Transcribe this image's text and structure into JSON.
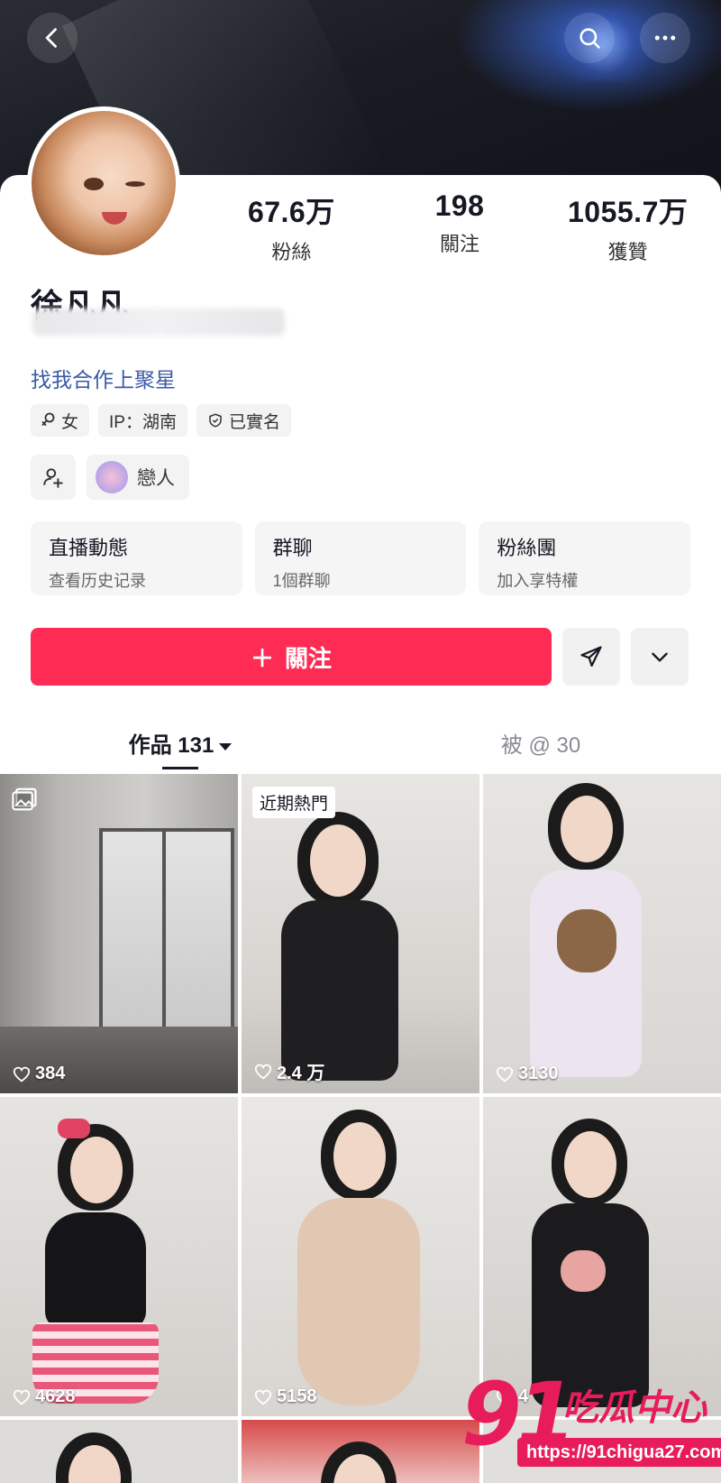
{
  "header": {
    "back_icon": "chevron-left-icon",
    "search_icon": "search-icon",
    "more_icon": "more-horizontal-icon"
  },
  "profile": {
    "name": "徐凡凡",
    "bio_link": "找我合作上聚星",
    "stats": [
      {
        "value": "67.6万",
        "label": "粉絲"
      },
      {
        "value": "198",
        "label": "關注"
      },
      {
        "value": "1055.7万",
        "label": "獲贊"
      }
    ],
    "tags": [
      {
        "icon": "female-icon",
        "text": "女"
      },
      {
        "icon": "",
        "text": "IP：湖南"
      },
      {
        "icon": "shield-icon",
        "text": "已實名"
      }
    ],
    "relation_label": "戀人"
  },
  "info_cards": [
    {
      "title": "直播動態",
      "subtitle": "查看历史记录"
    },
    {
      "title": "群聊",
      "subtitle": "1個群聊"
    },
    {
      "title": "粉絲團",
      "subtitle": "加入享特權"
    }
  ],
  "actions": {
    "follow_label": "關注",
    "follow_prefix": "＋"
  },
  "tabs": [
    {
      "label": "作品 131",
      "active": true
    },
    {
      "label": "被 @ 30",
      "active": false
    }
  ],
  "videos": [
    {
      "likes": "384",
      "badge": "",
      "image_post": true
    },
    {
      "likes": "2.4 万",
      "badge": "近期熱門",
      "image_post": false
    },
    {
      "likes": "3130",
      "badge": "",
      "image_post": false
    },
    {
      "likes": "4628",
      "badge": "",
      "image_post": false
    },
    {
      "likes": "5158",
      "badge": "",
      "image_post": false
    },
    {
      "likes": "4",
      "badge": "",
      "image_post": false
    }
  ],
  "watermark": {
    "num": "91",
    "text": "吃瓜中心",
    "url": "https://91chigua27.com"
  },
  "colors": {
    "accent": "#fe2c55",
    "link": "#3a5aa8",
    "watermark": "#e81c5a"
  }
}
